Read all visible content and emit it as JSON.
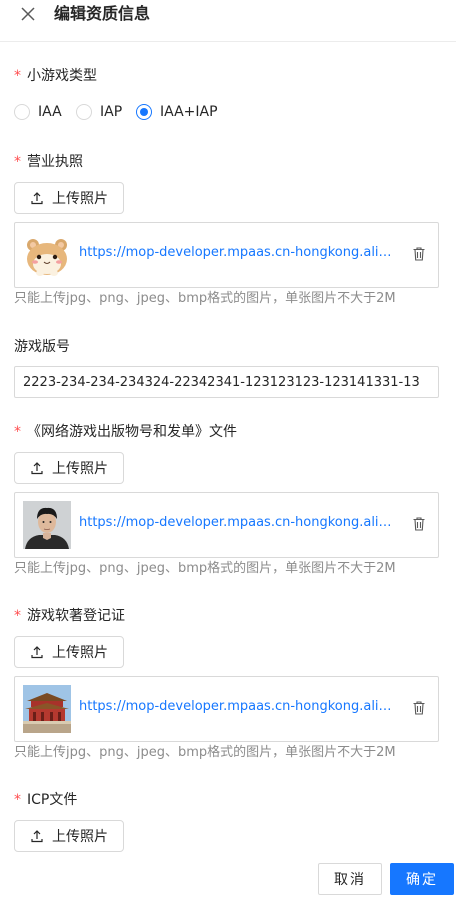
{
  "header": {
    "title": "编辑资质信息"
  },
  "game_type": {
    "label": "小游戏类型",
    "required": "*",
    "options": [
      {
        "label": "IAA",
        "checked": false
      },
      {
        "label": "IAP",
        "checked": false
      },
      {
        "label": "IAA+IAP",
        "checked": true
      }
    ]
  },
  "business_license": {
    "label": "营业执照",
    "required": "*",
    "upload_label": "上传照片",
    "file_url": "https://mop-developer.mpaas.cn-hongkong.aliyuncs.com/",
    "thumbnail": "hamster-image",
    "hint": "只能上传jpg、png、jpeg、bmp格式的图片，单张图片不大于2M"
  },
  "version_number": {
    "label": "游戏版号",
    "value": "2223-234-234-234324-22342341-123123123-123141331-13"
  },
  "publication_doc": {
    "label": "《网络游戏出版物号和发单》文件",
    "required": "*",
    "upload_label": "上传照片",
    "file_url": "https://mop-developer.mpaas.cn-hongkong.aliyuncs.com/",
    "thumbnail": "portrait-image",
    "hint": "只能上传jpg、png、jpeg、bmp格式的图片，单张图片不大于2M"
  },
  "software_copyright": {
    "label": "游戏软著登记证",
    "required": "*",
    "upload_label": "上传照片",
    "file_url": "https://mop-developer.mpaas.cn-hongkong.aliyuncs.com/",
    "thumbnail": "palace-image",
    "hint": "只能上传jpg、png、jpeg、bmp格式的图片，单张图片不大于2M"
  },
  "icp": {
    "label": "ICP文件",
    "required": "*",
    "upload_label": "上传照片"
  },
  "footer": {
    "cancel_label": "取消",
    "ok_label": "确定"
  },
  "colors": {
    "primary": "#1677ff",
    "required": "#ff4d4f",
    "hint": "#8c8c8c",
    "border": "#d9d9d9"
  },
  "icons": {
    "close": "close-icon",
    "upload": "upload-icon",
    "delete": "trash-icon"
  }
}
